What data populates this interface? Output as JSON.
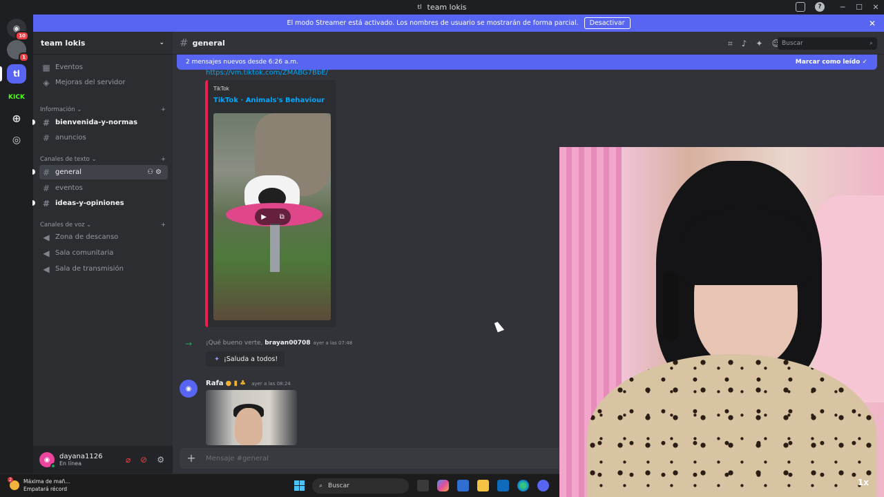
{
  "window": {
    "title": "team lokis",
    "title_icon": "tl"
  },
  "banner": {
    "text": "El modo Streamer está activado. Los nombres de usuario se mostrarán de forma parcial.",
    "button": "Desactivar"
  },
  "rail": {
    "home_badge": "10",
    "server1_badge": "1",
    "active_server": "tl",
    "kick_label": "KICK"
  },
  "sidebar": {
    "server_name": "team lokis",
    "top_items": [
      "Eventos",
      "Mejoras del servidor"
    ],
    "categories": {
      "info": "Información",
      "text": "Canales de texto",
      "voice": "Canales de voz"
    },
    "info_channels": [
      "bienvenida-y-normas",
      "anuncios"
    ],
    "text_channels": [
      "general",
      "eventos",
      "ideas-y-opiniones"
    ],
    "voice_channels": [
      "Zona de descanso",
      "Sala comunitaria",
      "Sala de transmisión"
    ]
  },
  "user": {
    "name": "dayana1126",
    "status": "En línea"
  },
  "header": {
    "channel": "general",
    "search_placeholder": "Buscar"
  },
  "chat": {
    "new_messages": "2 mensajes nuevos desde 6:26 a.m.",
    "mark_read": "Marcar como leído",
    "link": "https://vm.tiktok.com/ZMABG7BbE/",
    "embed_provider": "TikTok",
    "embed_title": "TikTok · Animals's Behaviour",
    "join_text": "¡Qué bueno verte,",
    "join_user": "brayan00708",
    "join_time": "ayer a las 07:48",
    "wave_button": "¡Saluda a todos!",
    "msg_author": "Rafa",
    "msg_time": "ayer a las 08:24",
    "composer_placeholder": "Mensaje #general"
  },
  "webcam": {
    "label": "1x"
  },
  "taskbar": {
    "weather_badge": "2",
    "weather_title": "Máxima de mañ...",
    "weather_sub": "Empatará récord",
    "search_placeholder": "Buscar"
  },
  "colors": {
    "blurple": "#5865f2",
    "tiktok": "#ee1d52",
    "online": "#23a55a"
  }
}
